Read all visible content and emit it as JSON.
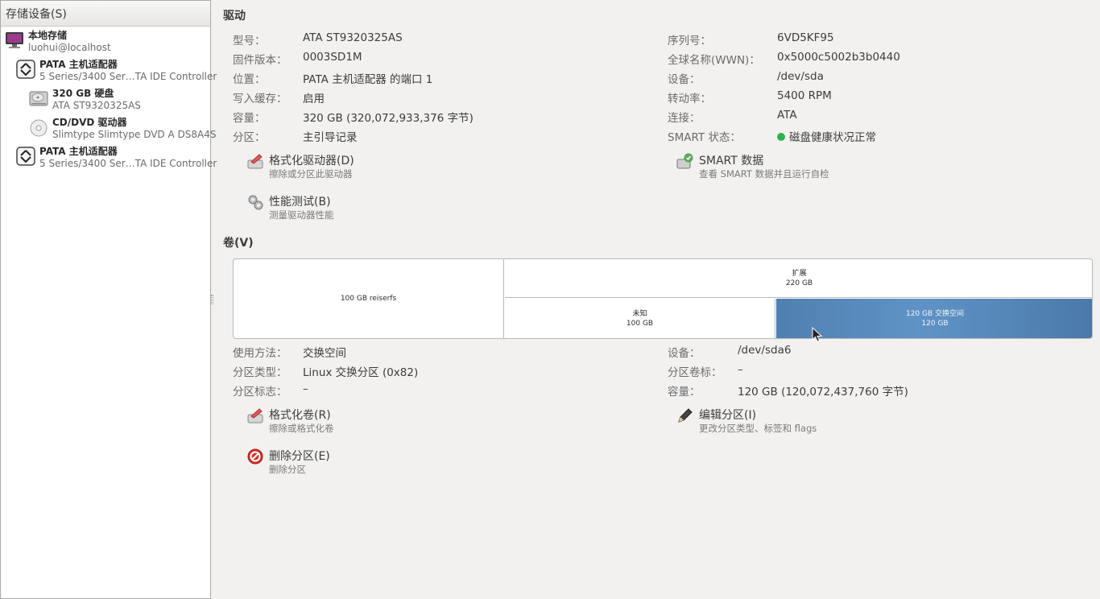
{
  "sidebar": {
    "header": "存储设备(S)",
    "items": [
      {
        "title": "本地存储",
        "subtitle": "luohui@localhost",
        "icon": "computer-icon"
      },
      {
        "title": "PATA 主机适配器",
        "subtitle": "5 Series/3400 Ser…TA IDE Controller",
        "icon": "adapter-icon"
      },
      {
        "title": "320 GB 硬盘",
        "subtitle": "ATA ST9320325AS",
        "icon": "hard-disk-icon"
      },
      {
        "title": "CD/DVD 驱动器",
        "subtitle": "Slimtype Slimtype DVD A  DS8A4S",
        "icon": "optical-disc-icon"
      },
      {
        "title": "PATA 主机适配器",
        "subtitle": "5 Series/3400 Ser…TA IDE Controller",
        "icon": "adapter-icon"
      }
    ]
  },
  "drive": {
    "title": "驱动",
    "left": [
      {
        "label": "型号：",
        "value": "ATA ST9320325AS"
      },
      {
        "label": "固件版本：",
        "value": "0003SD1M"
      },
      {
        "label": "位置：",
        "value": "PATA 主机适配器 的端口 1"
      },
      {
        "label": "写入缓存：",
        "value": "启用"
      },
      {
        "label": "容量：",
        "value": "320 GB (320,072,933,376 字节)"
      },
      {
        "label": "分区：",
        "value": "主引导记录"
      }
    ],
    "right": [
      {
        "label": "序列号：",
        "value": "6VD5KF95"
      },
      {
        "label": "全球名称(WWN)：",
        "value": "0x5000c5002b3b0440"
      },
      {
        "label": "设备：",
        "value": "/dev/sda"
      },
      {
        "label": "转动率：",
        "value": "5400 RPM"
      },
      {
        "label": "连接：",
        "value": "ATA"
      },
      {
        "label": "SMART 状态：",
        "value": "磁盘健康状况正常",
        "status_color": "#2bb34a"
      }
    ],
    "actions": {
      "format": {
        "title": "格式化驱动器(D)",
        "desc": "擦除或分区此驱动器",
        "icon": "format-drive-icon"
      },
      "smart": {
        "title": "SMART 数据",
        "desc": "查看 SMART 数据并且运行自检",
        "icon": "smart-data-icon"
      },
      "benchmark": {
        "title": "性能测试(B)",
        "desc": "测量驱动器性能",
        "icon": "benchmark-icon"
      }
    }
  },
  "volumes": {
    "title": "卷(V)",
    "segments": {
      "reiserfs": {
        "line1": "100 GB reiserfs",
        "size_gb": 100
      },
      "extended": {
        "line1": "扩展",
        "line2": "220 GB",
        "size_gb": 220
      },
      "unknown": {
        "line1": "未知",
        "line2": "100 GB",
        "size_gb": 100
      },
      "swap": {
        "line1": "120 GB 交换空间",
        "line2": "120 GB",
        "size_gb": 120,
        "selected": true,
        "color": "#5588bb"
      }
    },
    "details_left": [
      {
        "label": "使用方法：",
        "value": "交换空间"
      },
      {
        "label": "分区类型：",
        "value": "Linux 交换分区 (0x82)"
      },
      {
        "label": "分区标志：",
        "value": "–"
      }
    ],
    "details_right": [
      {
        "label": "设备：",
        "value": "/dev/sda6"
      },
      {
        "label": "分区卷标：",
        "value": "–"
      },
      {
        "label": "容量：",
        "value": "120 GB (120,072,437,760 字节)"
      }
    ],
    "actions": {
      "format_volume": {
        "title": "格式化卷(R)",
        "desc": "擦除或格式化卷",
        "icon": "format-volume-icon"
      },
      "edit_partition": {
        "title": "编辑分区(I)",
        "desc": "更改分区类型、标签和 flags",
        "icon": "pencil-icon"
      },
      "delete_partition": {
        "title": "删除分区(E)",
        "desc": "删除分区",
        "icon": "delete-icon"
      }
    }
  }
}
